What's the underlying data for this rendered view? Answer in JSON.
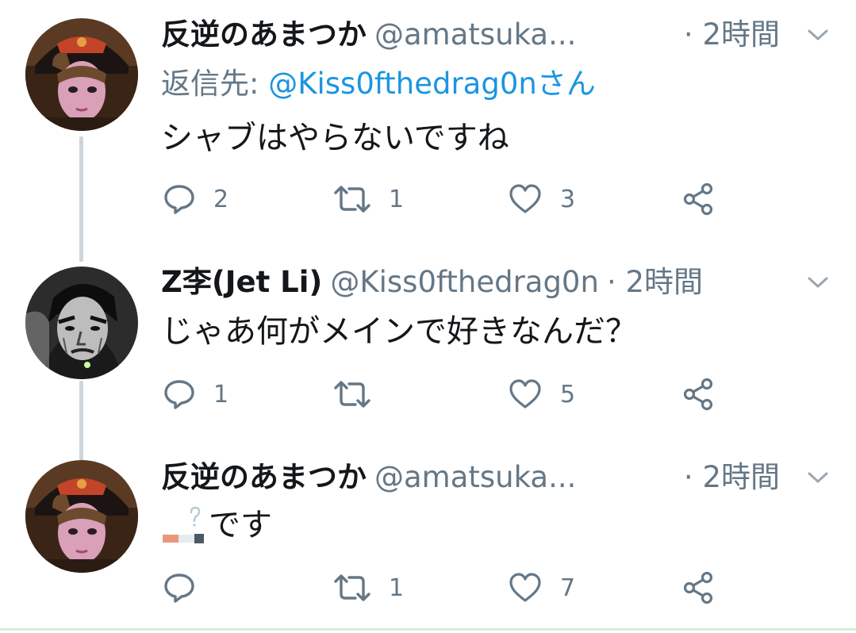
{
  "tweets": [
    {
      "display_name": "反逆のあまつか",
      "handle": "@amatsuka...",
      "time": "· 2時間",
      "reply_label": "返信先: ",
      "reply_to": "@Kiss0fthedrag0nさん",
      "text": "シャブはやらないですね",
      "emoji_icon": "cigarette-icon",
      "counts": {
        "reply": "2",
        "retweet": "1",
        "like": "3"
      }
    },
    {
      "display_name": "Z李(Jet Li)",
      "handle": "@Kiss0fthedrag0n",
      "time": "· 2時間",
      "text": "じゃあ何がメインで好きなんだ？",
      "counts": {
        "reply": "1",
        "retweet": "",
        "like": "5"
      }
    },
    {
      "display_name": "反逆のあまつか",
      "handle": "@amatsuka...",
      "time": "· 2時間",
      "text": "です",
      "emoji_icon": "cigarette-icon",
      "counts": {
        "reply": "",
        "retweet": "1",
        "like": "7"
      }
    }
  ],
  "colors": {
    "text": "#14171a",
    "secondary": "#657786",
    "link": "#1b95e0",
    "thread_line": "#cdd6dd"
  }
}
